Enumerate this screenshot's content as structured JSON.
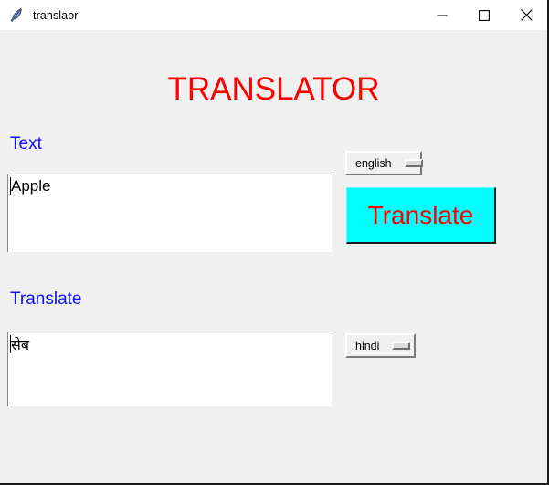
{
  "window": {
    "title": "translaor",
    "icon": "feather-icon",
    "controls": {
      "minimize_label": "—",
      "maximize_label": "□",
      "close_label": "×"
    }
  },
  "app": {
    "heading": "TRANSLATOR",
    "heading_color": "#fe0000",
    "background_color": "#f0f0f0"
  },
  "source": {
    "label": "Text",
    "label_color": "#1111ee",
    "value": "Apple",
    "language": "english"
  },
  "target": {
    "label": "Translate",
    "label_color": "#1111ee",
    "value": "सेब",
    "language": "hindi"
  },
  "translate_button": {
    "label": "Translate",
    "background_color": "#00ffff",
    "text_color": "#fe0000"
  }
}
